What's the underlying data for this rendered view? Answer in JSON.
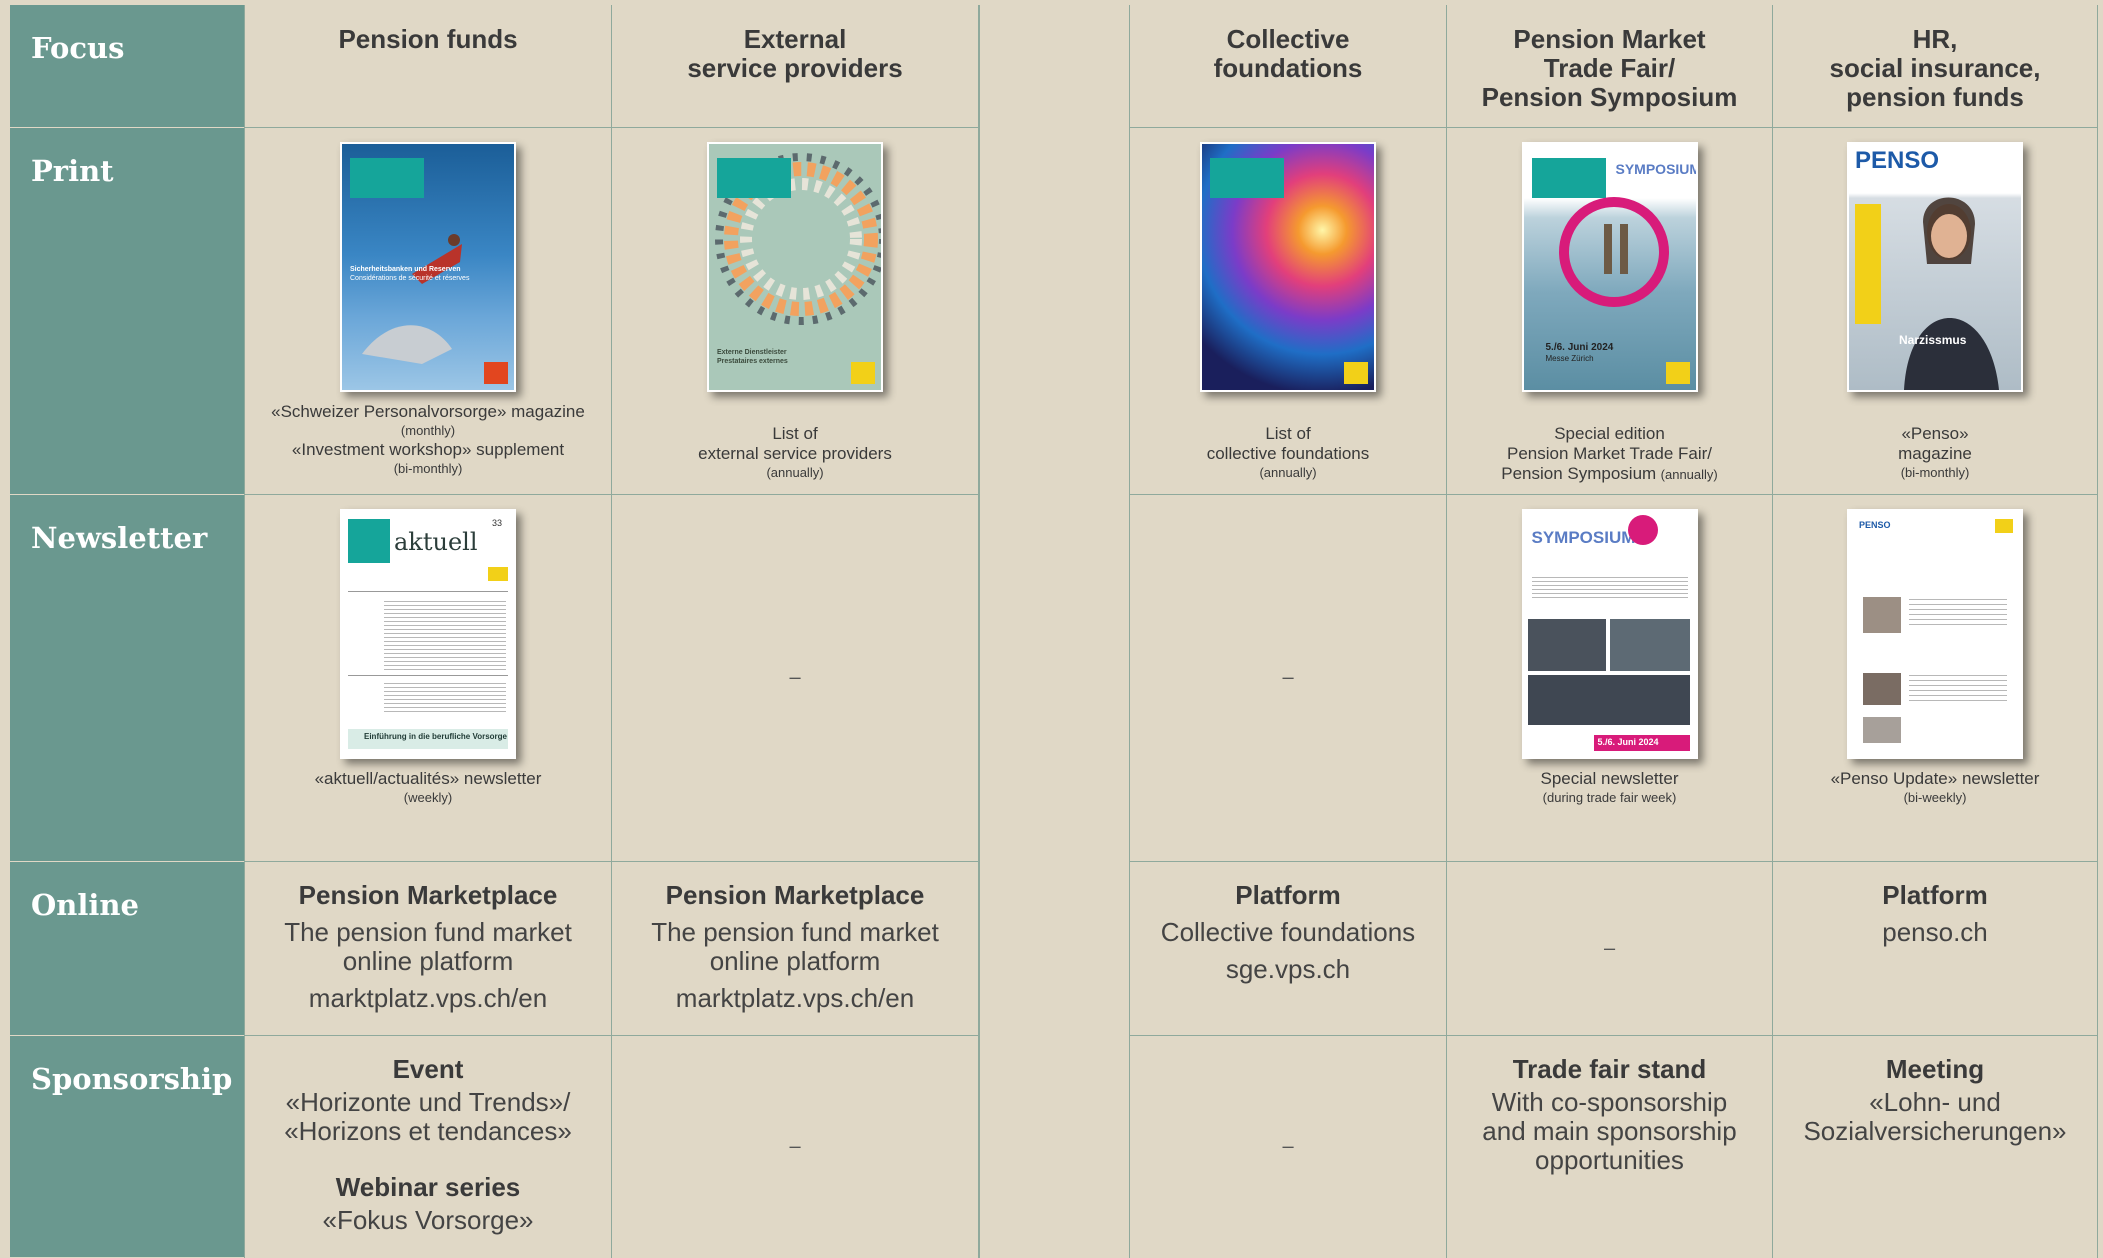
{
  "header": {
    "focus": "Focus",
    "col1": "Pension funds",
    "col2a": "External",
    "col2b": "service providers",
    "col3a": "Collective",
    "col3b": "foundations",
    "col4a": "Pension Market",
    "col4b": "Trade Fair/",
    "col4c": "Pension Symposium",
    "col5a": "HR,",
    "col5b": "social insurance,",
    "col5c": "pension funds"
  },
  "rows": {
    "print": "Print",
    "newsletter": "Newsletter",
    "online": "Online",
    "sponsorship": "Sponsorship"
  },
  "print": {
    "c1_l1": "«Schweizer Personalvorsorge» magazine",
    "c1_l2": "(monthly)",
    "c1_l3": "«Investment workshop» supplement",
    "c1_l4": "(bi-monthly)",
    "c2_l1": "List of",
    "c2_l2": "external service providers",
    "c2_l3": "(annually)",
    "c3_l1": "List of",
    "c3_l2": "collective foundations",
    "c3_l3": "(annually)",
    "c4_l1": "Special edition",
    "c4_l2": "Pension Market Trade Fair/",
    "c4_l3a": "Pension Symposium",
    "c4_l3b": "(annually)",
    "c5_l1": "«Penso»",
    "c5_l2": "magazine",
    "c5_l3": "(bi-monthly)",
    "cover1_title": "Sicherheitsbanken und Reserven",
    "cover1_sub": "Considérations de sécurité et réserves",
    "cover2_title": "Externe Dienstleister",
    "cover2_sub": "Prestataires externes",
    "cover4_date": "5./6. Juni 2024",
    "cover4_place": "Messe Zürich",
    "cover5_logo": "PENSO",
    "cover5_word": "Narzissmus"
  },
  "newsletter": {
    "c1_l1": "«aktuell/actualités» newsletter",
    "c1_l2": "(weekly)",
    "c1_mast": "aktuell",
    "c1_num": "33",
    "c1_banner": "Einführung in die berufliche Vorsorge",
    "c2": "–",
    "c3": "–",
    "c4_l1": "Special newsletter",
    "c4_l2": "(during trade fair week)",
    "c4_brand": "SYMPOSIUM",
    "c4_date": "5./6. Juni 2024",
    "c5_l1": "«Penso Update» newsletter",
    "c5_l2": "(bi-weekly)",
    "c5_logo": "PENSO"
  },
  "online": {
    "c1_head": "Pension Marketplace",
    "c1_l1": "The pension fund market",
    "c1_l2": "online platform",
    "c1_url": "marktplatz.vps.ch/en",
    "c2_head": "Pension Marketplace",
    "c2_l1": "The pension fund market",
    "c2_l2": "online platform",
    "c2_url": "marktplatz.vps.ch/en",
    "c3_head": "Platform",
    "c3_l1": "Collective foundations",
    "c3_url": "sge.vps.ch",
    "c4": "–",
    "c5_head": "Platform",
    "c5_url": "penso.ch"
  },
  "sponsorship": {
    "c1_head": "Event",
    "c1_l1": "«Horizonte und Trends»/",
    "c1_l2": "«Horizons et tendances»",
    "c1_head2": "Webinar series",
    "c1_l3": "«Fokus Vorsorge»",
    "c2": "–",
    "c3": "–",
    "c4_head": "Trade fair stand",
    "c4_l1": "With co-sponsorship",
    "c4_l2": "and main sponsorship",
    "c4_l3": "opportunities",
    "c5_head": "Meeting",
    "c5_l1": "«Lohn- und",
    "c5_l2": "Sozialversicherungen»"
  },
  "colors": {
    "background": "#e0d8c6",
    "header_column": "#6a988f",
    "grid_line": "#8fa99c",
    "accent_teal": "#15a59a",
    "accent_yellow": "#f2d018",
    "accent_magenta": "#d81b7a"
  }
}
